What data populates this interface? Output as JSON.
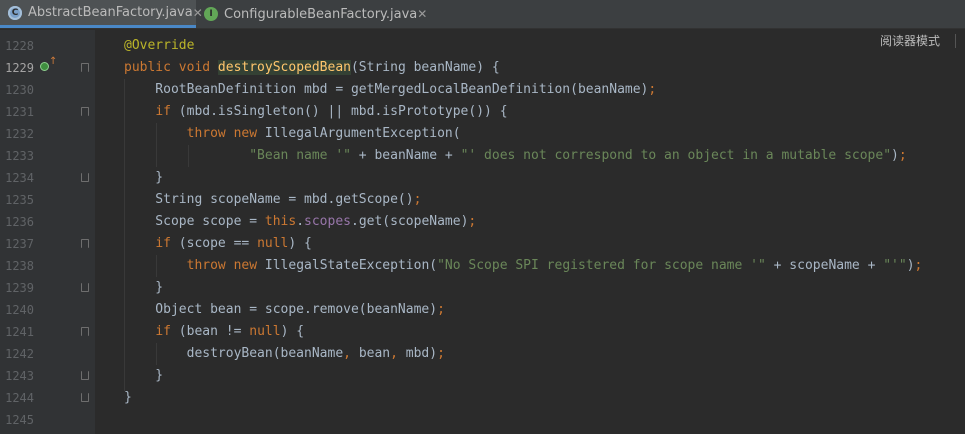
{
  "tabs": [
    {
      "label": "AbstractBeanFactory.java",
      "icon": "class-icon",
      "active": true
    },
    {
      "label": "ConfigurableBeanFactory.java",
      "icon": "interface-icon",
      "active": false
    }
  ],
  "reader_mode": "阅读器模式",
  "current_line": "1229",
  "lines": [
    {
      "num": "1228"
    },
    {
      "num": "1229"
    },
    {
      "num": "1230"
    },
    {
      "num": "1231"
    },
    {
      "num": "1232"
    },
    {
      "num": "1233"
    },
    {
      "num": "1234"
    },
    {
      "num": "1235"
    },
    {
      "num": "1236"
    },
    {
      "num": "1237"
    },
    {
      "num": "1238"
    },
    {
      "num": "1239"
    },
    {
      "num": "1240"
    },
    {
      "num": "1241"
    },
    {
      "num": "1242"
    },
    {
      "num": "1243"
    },
    {
      "num": "1244"
    },
    {
      "num": "1245"
    }
  ],
  "code": {
    "l1228": "@Override",
    "l1229": "public void destroyScopedBean(String beanName) {",
    "l1230": "RootBeanDefinition mbd = getMergedLocalBeanDefinition(beanName);",
    "l1231": "if (mbd.isSingleton() || mbd.isPrototype()) {",
    "l1232": "throw new IllegalArgumentException(",
    "l1233": "\"Bean name '\" + beanName + \"' does not correspond to an object in a mutable scope\");",
    "l1234": "}",
    "l1235": "String scopeName = mbd.getScope();",
    "l1236": "Scope scope = this.scopes.get(scopeName);",
    "l1237": "if (scope == null) {",
    "l1238": "throw new IllegalStateException(\"No Scope SPI registered for scope name '\" + scopeName + \"'\");",
    "l1239": "}",
    "l1240": "Object bean = scope.remove(beanName);",
    "l1241": "if (bean != null) {",
    "l1242": "destroyBean(beanName, bean, mbd);",
    "l1243": "}",
    "l1244": "}",
    "l1245": ""
  },
  "colors": {
    "background": "#2b2b2b",
    "keyword": "#cc7832",
    "string": "#6a8759",
    "annotation": "#bbb529",
    "field": "#9876aa",
    "text": "#a9b7c6"
  }
}
